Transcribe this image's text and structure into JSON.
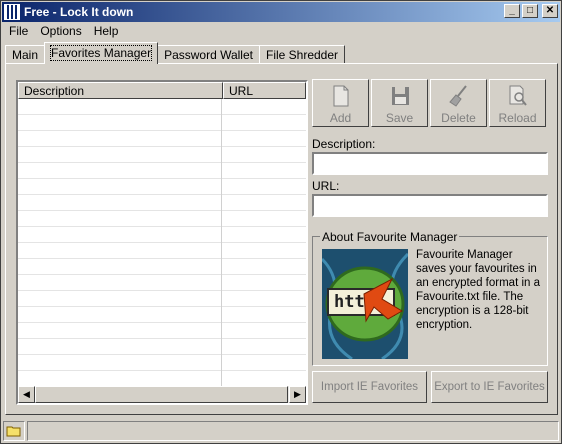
{
  "window": {
    "title": "Free - Lock It down",
    "minimize": "_",
    "maximize": "□",
    "close": "✕"
  },
  "menu": [
    "File",
    "Options",
    "Help"
  ],
  "tabs": [
    {
      "label": "Main",
      "active": false
    },
    {
      "label": "Favorites Manager",
      "active": true
    },
    {
      "label": "Password Wallet",
      "active": false
    },
    {
      "label": "File Shredder",
      "active": false
    }
  ],
  "list": {
    "columns": [
      "Description",
      "URL"
    ],
    "rows": []
  },
  "toolbar": {
    "add": "Add",
    "save": "Save",
    "delete": "Delete",
    "reload": "Reload"
  },
  "form": {
    "description_label": "Description:",
    "description_value": "",
    "url_label": "URL:",
    "url_value": ""
  },
  "about": {
    "title": "About Favourite Manager",
    "text": "Favourite Manager saves your favourites in an encrypted format in a Favourite.txt file. The encryption is a 128-bit encryption.",
    "image_text": "htt"
  },
  "buttons": {
    "import": "Import IE Favorites",
    "export": "Export to IE Favorites"
  },
  "colors": {
    "title_start": "#0a246a",
    "title_end": "#a6caf0",
    "face": "#d4d0c8",
    "disabled_text": "#808080"
  },
  "icons": {
    "app": "app-icon",
    "add": "document-icon",
    "save": "floppy-disk-icon",
    "delete": "broom-icon",
    "reload": "magnifier-document-icon",
    "status": "folder-icon"
  }
}
